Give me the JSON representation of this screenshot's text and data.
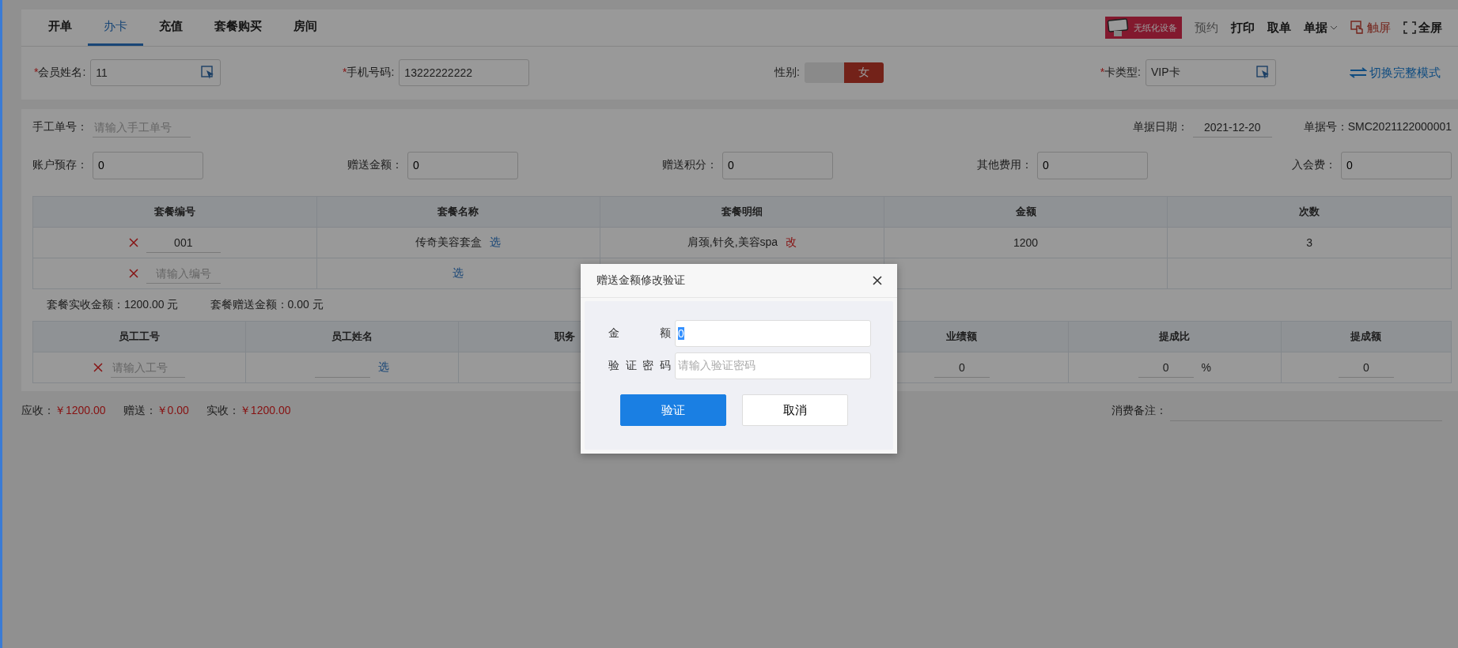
{
  "tabs": [
    {
      "label": "开单",
      "selected": false
    },
    {
      "label": "办卡",
      "selected": true
    },
    {
      "label": "充值",
      "selected": false
    },
    {
      "label": "套餐购买",
      "selected": false
    },
    {
      "label": "房间",
      "selected": false
    }
  ],
  "toolbar": {
    "badge": "无纸化设备",
    "items": [
      {
        "label": "预约",
        "kind": "muted"
      },
      {
        "label": "打印",
        "kind": "plain"
      },
      {
        "label": "取单",
        "kind": "plain"
      },
      {
        "label": "单据",
        "kind": "dropdown"
      },
      {
        "label": "触屏",
        "kind": "touch"
      },
      {
        "label": "全屏",
        "kind": "fullscreen"
      }
    ]
  },
  "member": {
    "name": {
      "mark": "*",
      "label": "会员姓名:",
      "value": "11"
    },
    "phone": {
      "mark": "*",
      "label": "手机号码:",
      "value": "13222222222"
    },
    "gender": {
      "label": "性别:",
      "value": "女"
    },
    "card_type": {
      "mark": "*",
      "label": "卡类型:",
      "value": "VIP卡"
    },
    "switch_link": "切换完整模式"
  },
  "order": {
    "manual_no": {
      "label": "手工单号：",
      "placeholder": "请输入手工单号"
    },
    "date": {
      "label": "单据日期：",
      "value": "2021-12-20"
    },
    "number": "单据号：SMC2021122000001"
  },
  "amounts": [
    {
      "label": "账户预存：",
      "value": "0"
    },
    {
      "label": "赠送金额：",
      "value": "0"
    },
    {
      "label": "赠送积分：",
      "value": "0"
    },
    {
      "label": "其他费用：",
      "value": "0"
    },
    {
      "label": "入会费：",
      "value": "0"
    }
  ],
  "package_table": {
    "columns": [
      "套餐编号",
      "套餐名称",
      "套餐明细",
      "金额",
      "次数"
    ],
    "rows": [
      {
        "code": "001",
        "name": "传奇美容套盒",
        "pick": "选",
        "detail": "肩颈,针灸,美容spa",
        "edit": "改",
        "amount": "1200",
        "count": "3"
      },
      {
        "code_placeholder": "请输入编号",
        "pick": "选"
      }
    ]
  },
  "package_summary": [
    {
      "label": "套餐实收金额：",
      "value": "1200.00 元"
    },
    {
      "label": "套餐赠送金额：",
      "value": "0.00 元"
    }
  ],
  "staff_table": {
    "columns": [
      "员工工号",
      "员工姓名",
      "职务",
      "业绩额",
      "提成比",
      "提成额"
    ],
    "rows": [
      {
        "id_placeholder": "请输入工号",
        "pick": "选",
        "performance": "0",
        "ratio": "0",
        "ratio_unit": "%",
        "commission": "0"
      }
    ]
  },
  "totals": [
    {
      "label": "应收：",
      "value": "￥1200.00"
    },
    {
      "label": "赠送：",
      "value": "￥0.00"
    },
    {
      "label": "实收：",
      "value": "￥1200.00"
    }
  ],
  "remark": {
    "label": "消费备注："
  },
  "dialog": {
    "title": "赠送金额修改验证",
    "fields": [
      {
        "label": "金　　额",
        "value": "0"
      },
      {
        "label": "验 证 密 码",
        "placeholder": "请输入验证密码"
      }
    ],
    "buttons": [
      {
        "label": "验证",
        "kind": "primary"
      },
      {
        "label": "取消",
        "kind": "default"
      }
    ]
  }
}
